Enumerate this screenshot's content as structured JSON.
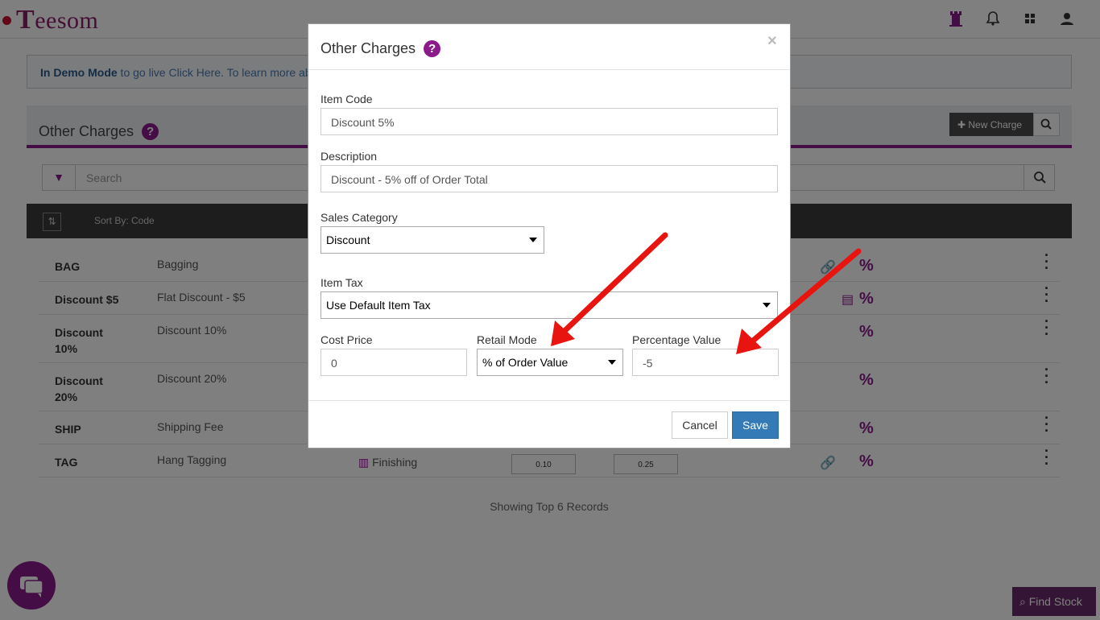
{
  "app": {
    "logo_text": "eesom",
    "logo_initial": "T"
  },
  "topbar": {
    "icons": [
      "tower-icon",
      "bell-icon",
      "grid-icon",
      "user-icon"
    ]
  },
  "demo_banner": {
    "strong": "In Demo Mode",
    "text": " to go live Click Here. To learn more ab"
  },
  "panel": {
    "title": "Other Charges",
    "help": "?",
    "new_charge_label": "New Charge",
    "filter_placeholder": "Search",
    "sort_label": "Sort By: Code",
    "showing": "Showing Top 6 Records"
  },
  "rows": [
    {
      "code": "BAG",
      "desc": "Bagging",
      "category": "",
      "v1": "",
      "v2": "",
      "pct": "%"
    },
    {
      "code": "Discount $5",
      "desc": "Flat Discount - $5",
      "category": "",
      "v1": "",
      "v2": "",
      "pct": "%"
    },
    {
      "code": "Discount 10%",
      "desc": "Discount 10%",
      "category": "",
      "v1": "",
      "v2": "",
      "pct": "%"
    },
    {
      "code": "Discount 20%",
      "desc": "Discount 20%",
      "category": "",
      "v1": "",
      "v2": "",
      "pct": "%"
    },
    {
      "code": "SHIP",
      "desc": "Shipping Fee",
      "category": "",
      "v1": "",
      "v2": "",
      "pct": "%"
    },
    {
      "code": "TAG",
      "desc": "Hang Tagging",
      "category": "Finishing",
      "v1": "0.10",
      "v2": "0.25",
      "pct": "%"
    }
  ],
  "find_stock": "Find Stock",
  "modal": {
    "title": "Other Charges",
    "help": "?",
    "close": "×",
    "item_code_label": "Item Code",
    "item_code_value": "Discount 5%",
    "description_label": "Description",
    "description_value": "Discount - 5% off of Order Total",
    "sales_category_label": "Sales Category",
    "sales_category_value": "Discount",
    "item_tax_label": "Item Tax",
    "item_tax_value": "Use Default Item Tax",
    "cost_price_label": "Cost Price",
    "cost_price_value": "0",
    "retail_mode_label": "Retail Mode",
    "retail_mode_value": "% of Order Value",
    "percentage_label": "Percentage Value",
    "percentage_value": "-5",
    "cancel": "Cancel",
    "save": "Save"
  },
  "colors": {
    "brand": "#8b1a8b",
    "save": "#337ab7",
    "arrow": "#e8140f"
  }
}
